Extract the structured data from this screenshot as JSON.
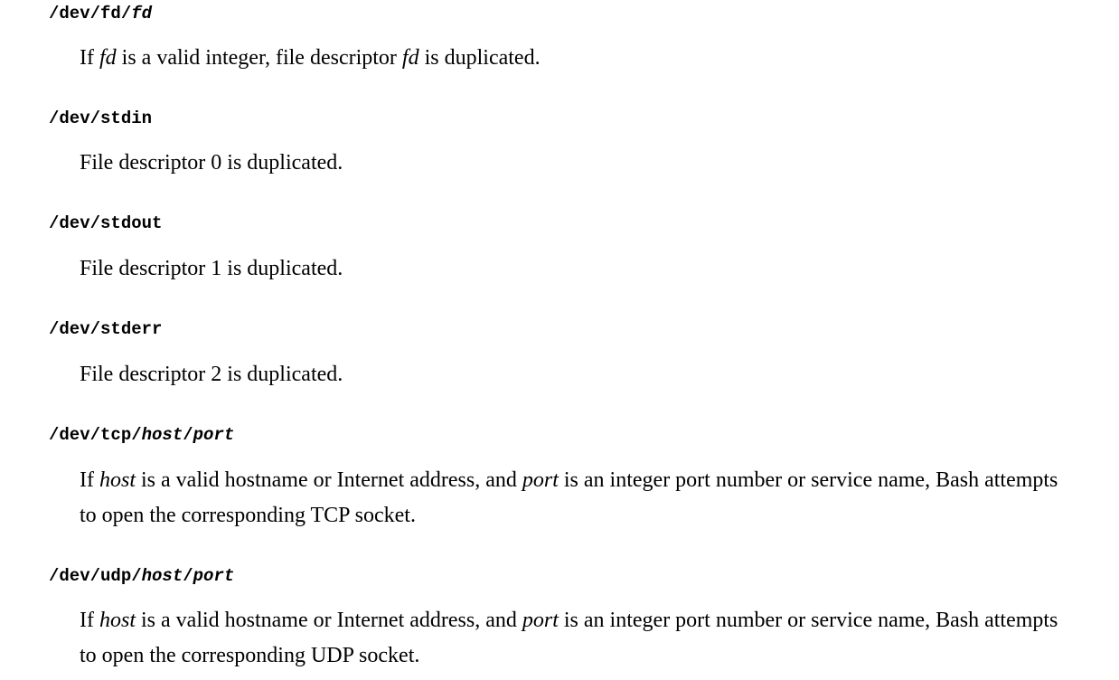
{
  "entries": [
    {
      "term": {
        "prefix": "/dev/fd/",
        "var": "fd"
      },
      "def": {
        "p1": "If ",
        "v1": "fd",
        "p2": " is a valid integer, file descriptor ",
        "v2": "fd",
        "p3": " is duplicated."
      }
    },
    {
      "term": {
        "text": "/dev/stdin"
      },
      "def": {
        "text": "File descriptor 0 is duplicated."
      }
    },
    {
      "term": {
        "text": "/dev/stdout"
      },
      "def": {
        "text": "File descriptor 1 is duplicated."
      }
    },
    {
      "term": {
        "text": "/dev/stderr"
      },
      "def": {
        "text": "File descriptor 2 is duplicated."
      }
    },
    {
      "term": {
        "prefix": "/dev/tcp/",
        "v1": "host",
        "sep": "/",
        "v2": "port"
      },
      "def": {
        "p1": "If ",
        "v1": "host",
        "p2": " is a valid hostname or Internet address, and ",
        "v2": "port",
        "p3": " is an integer port number or service name, Bash attempts to open the corresponding TCP socket."
      }
    },
    {
      "term": {
        "prefix": "/dev/udp/",
        "v1": "host",
        "sep": "/",
        "v2": "port"
      },
      "def": {
        "p1": "If ",
        "v1": "host",
        "p2": " is a valid hostname or Internet address, and ",
        "v2": "port",
        "p3": " is an integer port number or service name, Bash attempts to open the corresponding UDP socket."
      }
    }
  ]
}
